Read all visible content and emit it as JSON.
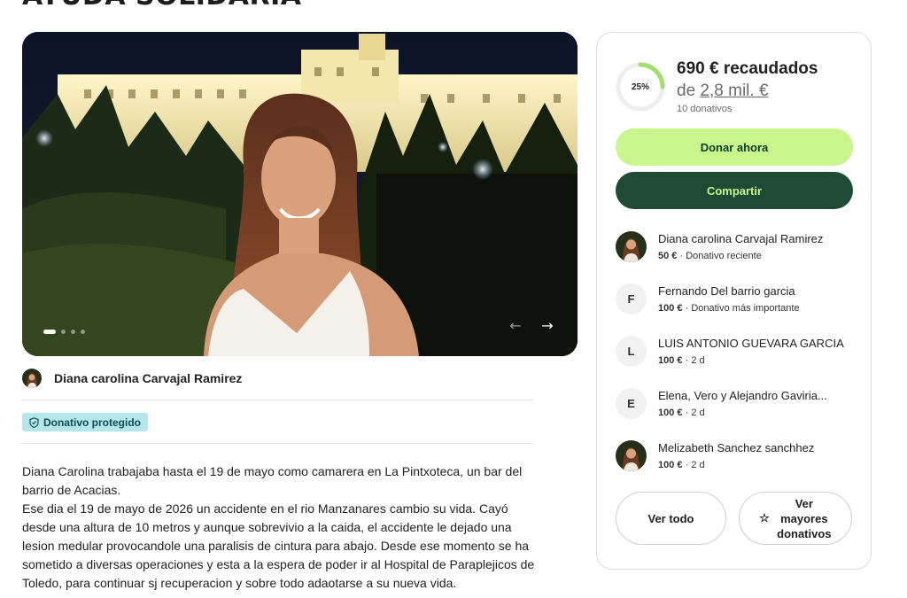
{
  "page": {
    "title": "AYUDA SOLIDARIA"
  },
  "hero": {
    "slide_count": 4,
    "active_slide": 1
  },
  "organizer": {
    "name": "Diana carolina Carvajal Ramirez"
  },
  "badge": {
    "label": "Donativo protegido"
  },
  "story": {
    "paragraphs": [
      "Diana Carolina trabajaba hasta el 19 de mayo como camarera en La Pintxoteca, un bar del barrio de Acacias.",
      "Ese dia el 19 de mayo de 2026 un accidente en el rio Manzanares cambio su vida. Cayó desde una altura de 10 metros y aunque sobrevivio a la caida, el accidente le dejado una lesion medular provocandole una paralisis de cintura para abajo. Desde ese momento se ha sometido a diversas operaciones y esta a la espera de poder ir al Hospital de Paraplejicos de Toledo, para continuar sj recuperacion y sobre todo adaotarse a su nueva vida."
    ]
  },
  "fundraiser": {
    "progress_percent": 25,
    "progress_label": "25%",
    "raised_text": "690 € recaudados",
    "goal_prefix": "de",
    "goal_amount": "2,8 mil. €",
    "donation_count": "10 donativos",
    "accent_color": "#c8f58c",
    "dark_color": "#1f4b34"
  },
  "actions": {
    "donate_label": "Donar ahora",
    "share_label": "Compartir",
    "see_all_label": "Ver todo",
    "see_top_label": "Ver mayores donativos"
  },
  "donors": [
    {
      "name": "Diana carolina Carvajal Ramirez",
      "initial": "",
      "photo": true,
      "amount": "50 €",
      "note": "Donativo reciente"
    },
    {
      "name": "Fernando Del barrio garcia",
      "initial": "F",
      "photo": false,
      "amount": "100 €",
      "note": "Donativo más importante"
    },
    {
      "name": "LUIS ANTONIO GUEVARA GARCIA",
      "initial": "L",
      "photo": false,
      "amount": "100 €",
      "note": "2 d"
    },
    {
      "name": "Elena, Vero y Alejandro Gaviria...",
      "initial": "E",
      "photo": false,
      "amount": "100 €",
      "note": "2 d"
    },
    {
      "name": "Melizabeth Sanchez sanchhez",
      "initial": "",
      "photo": true,
      "amount": "100 €",
      "note": "2 d"
    }
  ]
}
